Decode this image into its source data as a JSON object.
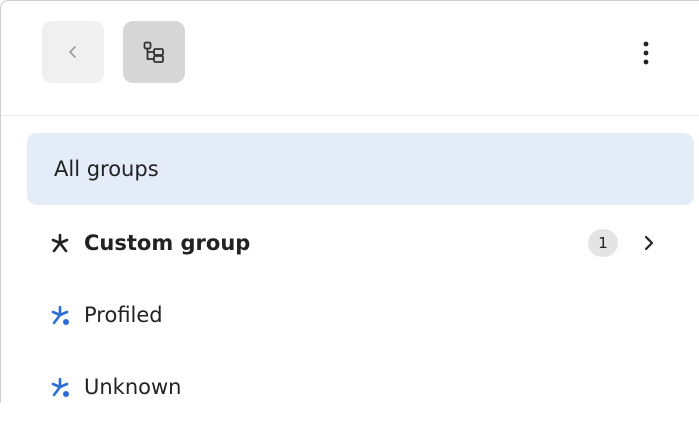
{
  "toolbar": {
    "back_icon": "chevron-left-icon",
    "tree_icon": "hierarchy-icon",
    "more_icon": "more-vertical-icon"
  },
  "groups": [
    {
      "label": "All groups",
      "selected": true
    },
    {
      "label": "Custom group",
      "bold": true,
      "icon": "custom-group-icon",
      "icon_color": "#222222",
      "count": "1",
      "expandable": true
    },
    {
      "label": "Profiled",
      "icon": "profiled-group-icon",
      "icon_color": "#2b6fd6"
    },
    {
      "label": "Unknown",
      "icon": "unknown-group-icon",
      "icon_color": "#2b6fd6"
    }
  ],
  "colors": {
    "selected_bg": "#e3ecf8",
    "accent": "#2b6fd6"
  }
}
